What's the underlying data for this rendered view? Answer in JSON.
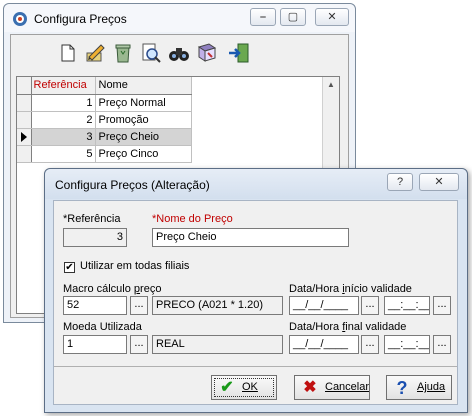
{
  "main_window": {
    "title": "Configura Preços",
    "title_buttons": [
      "⎯",
      "▢",
      "✕"
    ],
    "toolbar": [
      "new-doc-icon",
      "edit-pencil-icon",
      "recycle-delete-icon",
      "preview-search-icon",
      "find-binoculars-icon",
      "settings-icon",
      "exit-door-icon"
    ],
    "grid": {
      "columns": [
        "Referência",
        "Nome"
      ],
      "rows": [
        {
          "ref": "1",
          "nome": "Preço Normal"
        },
        {
          "ref": "2",
          "nome": "Promoção"
        },
        {
          "ref": "3",
          "nome": "Preço Cheio"
        },
        {
          "ref": "5",
          "nome": "Preço Cinco"
        }
      ],
      "selected_row": 2
    }
  },
  "dialog": {
    "title": "Configura Preços (Alteração)",
    "title_buttons": [
      "?",
      "✕"
    ],
    "referencia_label": "*Referência",
    "referencia_value": "3",
    "nome_label": "*Nome do Preço",
    "nome_value": "Preço Cheio",
    "utilizar_label": "Utilizar em todas filiais",
    "utilizar_checked": "✔",
    "macro_label_pre": "Macro cálculo ",
    "macro_label_u": "p",
    "macro_label_post": "reço",
    "macro_value": "52",
    "macro_desc": "PRECO (A021 * 1.20)",
    "inicio_label_pre": "Data/Hora ",
    "inicio_label_u": "i",
    "inicio_label_post": "nício validade",
    "date_mask": "__/__/____",
    "time_mask": "__:__:__",
    "moeda_label": "Moeda Utilizada",
    "moeda_value": "1",
    "moeda_desc": "REAL",
    "final_label_pre": "Data/Hora ",
    "final_label_u": "f",
    "final_label_post": "inal validade",
    "dots": "...",
    "ok_label": "OK",
    "cancelar_label": "Cancelar",
    "ajuda_label": "Ajuda",
    "accent_ok": "#1a9a1a",
    "accent_cancel": "#c01010",
    "accent_help": "#1a4fb0"
  }
}
